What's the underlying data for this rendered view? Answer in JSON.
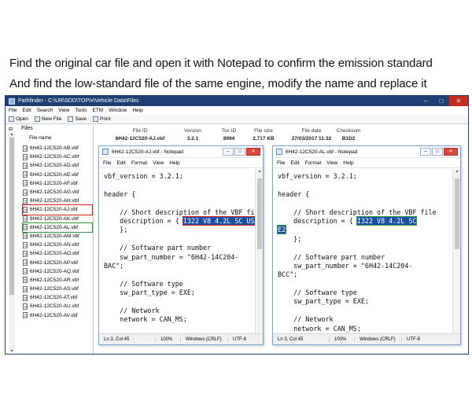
{
  "captions": {
    "line1": "Find the original car file and open it with Notepad to confirm the emission standard",
    "line2": "And find the low-standard file of the same engine, modify the name and replace it"
  },
  "pathfinder": {
    "title": "Pathfinder - C:\\UR\\SDD\\TOPIx\\Vehicle Data\\Files",
    "window_buttons": [
      "–",
      "□",
      "✕"
    ],
    "menu": [
      "File",
      "Edit",
      "Search",
      "View",
      "Tools",
      "ETM",
      "Window",
      "Help"
    ],
    "toolbar": {
      "open": "Open",
      "new_file": "New File",
      "save": "Save",
      "print": "Print"
    },
    "tree_root": "Files",
    "tree_toggle": "⊟",
    "column_file_name": "File name",
    "files": [
      "6H42-12C520-AB.vbf",
      "6H42-12C520-AC.vbf",
      "6H42-12C520-AD.vbf",
      "6H42-12C520-AE.vbf",
      "6H42-12C520-AF.vbf",
      "6H42-12C520-AG.vbf",
      "6H42-12C520-AH.vbf",
      "6H42-12C520-AJ.vbf",
      "6H42-12C520-AK.vbf",
      "6H42-12C520-AL.vbf",
      "6H42-12C520-AM.vbf",
      "6H42-12C520-AN.vbf",
      "6H42-12C520-AO.vbf",
      "6H42-12C520-AP.vbf",
      "6H42-12C520-AQ.vbf",
      "6H42-12C520-AR.vbf",
      "6H42-12C520-AS.vbf",
      "6H42-12C520-AT.vbf",
      "6H42-12C520-AU.vbf",
      "6H42-12C520-AV.vbf"
    ],
    "detail": {
      "file_id": {
        "label": "File ID",
        "value": "6H42-12C520-AJ.vbf"
      },
      "version": {
        "label": "Version",
        "value": "3.2.1"
      },
      "toc_id": {
        "label": "Toc ID",
        "value": "8994"
      },
      "file_size": {
        "label": "File size",
        "value": "2,717 KB"
      },
      "file_date": {
        "label": "File date",
        "value": "27/03/2017 11:32"
      },
      "checksum": {
        "label": "Checksum",
        "value": "B1D2"
      }
    }
  },
  "notepad_left": {
    "title": "6H42-12C520-AJ.vbf - Notepad",
    "menu": [
      "File",
      "Edit",
      "Format",
      "View",
      "Help"
    ],
    "lines": [
      "vbf_version = 3.2.1;",
      "",
      "header {",
      "",
      "    // Short description of the VBF file",
      "    description = { ",
      "    };",
      "",
      "    // Software part number",
      "    sw_part_number = \"6H42-14C204-",
      "BAC\";",
      "",
      "    // Software type",
      "    sw_part_type = EXE;",
      "",
      "    // Network",
      "    network = CAN_MS;"
    ],
    "selection": "I322 V8 4.2L SC US",
    "status": {
      "position": "Ln 3, Col 45",
      "zoom": "100%",
      "eol": "Windows (CRLF)",
      "encoding": "UTF-8"
    }
  },
  "notepad_right": {
    "title": "6H42-12C520-AL.vbf - Notepad",
    "menu": [
      "File",
      "Edit",
      "Format",
      "View",
      "Help"
    ],
    "lines": [
      "vbf_version = 3.2.1;",
      "",
      "header {",
      "",
      "    // Short description of the VBF file",
      "    description = { ",
      "",
      "    };",
      "",
      "    // Software part number",
      "    sw_part_number = \"6H42-14C204-",
      "BCC\";",
      "",
      "    // Software type",
      "    sw_part_type = EXE;",
      "",
      "    // Network",
      "    network = CAN_MS;"
    ],
    "selection_line1": "I322 V8 4.2L SC",
    "selection_line2": "E2",
    "status": {
      "position": "Ln 3, Col 45",
      "zoom": "100%",
      "eol": "Windows (CRLF)",
      "encoding": "UTF-8"
    }
  },
  "colors": {
    "titlebar": "#1e3f73",
    "highlight_red": "#d62020",
    "highlight_green": "#2c9a3a",
    "selection": "#1a4fa3"
  }
}
